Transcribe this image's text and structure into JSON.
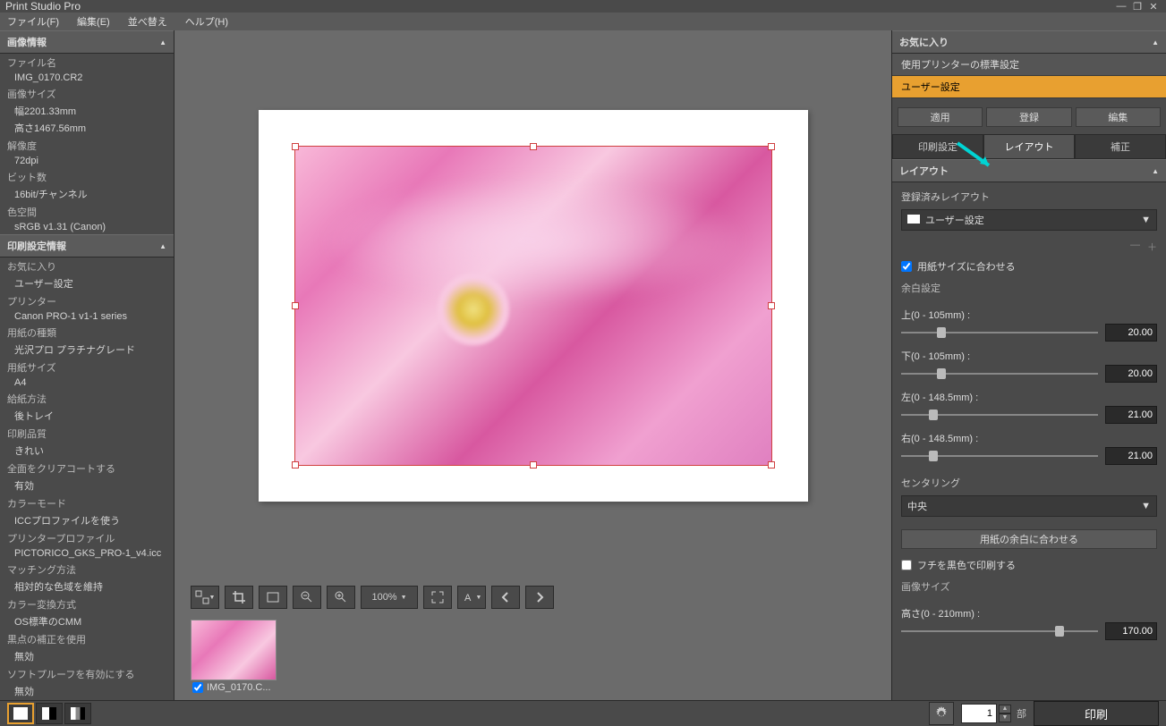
{
  "title": "Print Studio Pro",
  "menu": {
    "file": "ファイル(F)",
    "edit": "編集(E)",
    "sort": "並べ替え",
    "help": "ヘルプ(H)"
  },
  "left": {
    "image_info_header": "画像情報",
    "file_label": "ファイル名",
    "file_value": "IMG_0170.CR2",
    "size_label": "画像サイズ",
    "width": "幅2201.33mm",
    "height": "高さ1467.56mm",
    "res_label": "解像度",
    "res_value": "72dpi",
    "bit_label": "ビット数",
    "bit_value": "16bit/チャンネル",
    "cs_label": "色空間",
    "cs_value": "sRGB v1.31 (Canon)",
    "print_info_header": "印刷設定情報",
    "fav_label": "お気に入り",
    "fav_value": "ユーザー設定",
    "printer_label": "プリンター",
    "printer_value": "Canon PRO-1 v1-1 series",
    "media_label": "用紙の種類",
    "media_value": "光沢プロ プラチナグレード",
    "psize_label": "用紙サイズ",
    "psize_value": "A4",
    "source_label": "給紙方法",
    "source_value": "後トレイ",
    "quality_label": "印刷品質",
    "quality_value": "きれい",
    "clear_label": "全面をクリアコートする",
    "clear_value": "有効",
    "cmode_label": "カラーモード",
    "cmode_value": "ICCプロファイルを使う",
    "profile_label": "プリンタープロファイル",
    "profile_value": "PICTORICO_GKS_PRO-1_v4.icc",
    "match_label": "マッチング方法",
    "match_value": "相対的な色域を維持",
    "conv_label": "カラー変換方式",
    "conv_value": "OS標準のCMM",
    "bp_label": "黒点の補正を使用",
    "bp_value": "無効",
    "soft_label": "ソフトプルーフを有効にする",
    "soft_value": "無効"
  },
  "toolbar": {
    "zoom": "100%"
  },
  "thumb": {
    "name": "IMG_0170.C..."
  },
  "right": {
    "fav_header": "お気に入り",
    "fav_items": [
      "使用プリンターの標準設定",
      "ユーザー設定"
    ],
    "apply": "適用",
    "register": "登録",
    "edit": "編集",
    "tab_print": "印刷設定",
    "tab_layout": "レイアウト",
    "tab_corr": "補正",
    "layout_header": "レイアウト",
    "registered_layout": "登録済みレイアウト",
    "layout_selected": "ユーザー設定",
    "fit_paper": "用紙サイズに合わせる",
    "margin_header": "余白設定",
    "top_label": "上(0 - 105mm) :",
    "top_value": "20.00",
    "bottom_label": "下(0 - 105mm) :",
    "bottom_value": "20.00",
    "left_label": "左(0 - 148.5mm) :",
    "left_value": "21.00",
    "right_label": "右(0 - 148.5mm) :",
    "right_value": "21.00",
    "centering": "センタリング",
    "centering_value": "中央",
    "fit_margins": "用紙の余白に合わせる",
    "black_border": "フチを黒色で印刷する",
    "img_size_label": "画像サイズ",
    "height_label": "高さ(0 - 210mm) :",
    "height_value": "170.00"
  },
  "footer": {
    "copies": "1",
    "copies_unit": "部",
    "print": "印刷"
  }
}
